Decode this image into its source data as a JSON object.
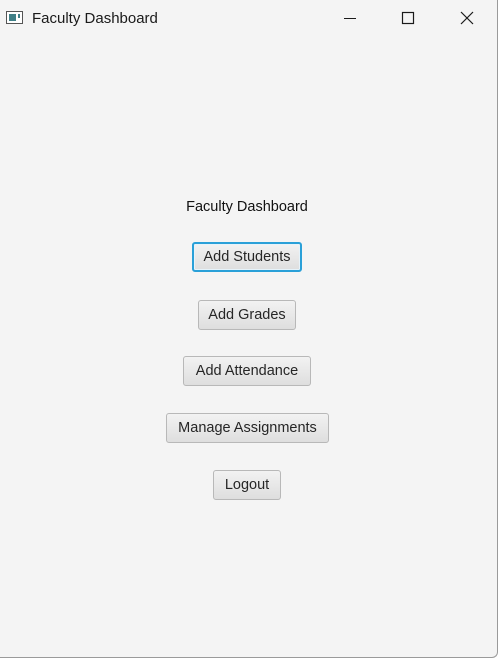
{
  "window": {
    "title": "Faculty Dashboard",
    "controls": {
      "minimize_icon": "minimize-icon",
      "maximize_icon": "maximize-icon",
      "close_icon": "close-icon"
    }
  },
  "main": {
    "heading": "Faculty Dashboard",
    "buttons": [
      {
        "label": "Add Students",
        "focused": true
      },
      {
        "label": "Add Grades",
        "focused": false
      },
      {
        "label": "Add Attendance",
        "focused": false
      },
      {
        "label": "Manage Assignments",
        "focused": false
      },
      {
        "label": "Logout",
        "focused": false
      }
    ]
  },
  "colors": {
    "background": "#f4f4f4",
    "focus_ring": "#2aa0d8",
    "app_icon_accent": "#3f7f86"
  }
}
